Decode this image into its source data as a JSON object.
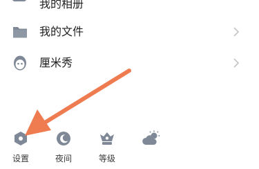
{
  "partial_item": {
    "label": "我的相册",
    "icon": "photo-album-icon"
  },
  "menu": [
    {
      "label": "我的文件",
      "icon": "folder-icon"
    },
    {
      "label": "厘米秀",
      "icon": "cmshow-avatar-icon"
    }
  ],
  "toolbar": [
    {
      "label": "设置",
      "icon": "settings-hexagon-icon"
    },
    {
      "label": "夜间",
      "icon": "night-mode-moon-icon"
    },
    {
      "label": "等级",
      "icon": "level-crown-icon"
    },
    {
      "label": "",
      "icon": "weather-icon"
    }
  ],
  "colors": {
    "icon_gray": "#7f8896",
    "arrow": "#ef7b50",
    "chevron": "#c4c4c4"
  }
}
